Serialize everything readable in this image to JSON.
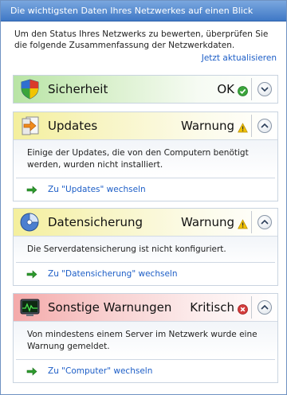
{
  "window": {
    "title": "Die wichtigsten Daten Ihres Netzwerkes auf einen Blick"
  },
  "intro": {
    "text": "Um den Status Ihres Netzwerks zu bewerten, überprüfen Sie die folgende Zusammenfassung der Netzwerkdaten.",
    "refresh_link": "Jetzt aktualisieren"
  },
  "colors": {
    "link": "#1d5ec7",
    "ok_green": "#3aa53a",
    "warning_yellow": "#f2c200",
    "critical_red": "#d43b3b"
  },
  "sections": {
    "security": {
      "title": "Sicherheit",
      "status": "OK",
      "status_icon": "ok-check-icon",
      "icon": "shield-icon",
      "expanded": false
    },
    "updates": {
      "title": "Updates",
      "status": "Warnung",
      "status_icon": "warning-icon",
      "icon": "updates-icon",
      "expanded": true,
      "description": "Einige der Updates, die von den Computern benötigt werden, wurden nicht installiert.",
      "link": "Zu \"Updates\" wechseln"
    },
    "backup": {
      "title": "Datensicherung",
      "status": "Warnung",
      "status_icon": "warning-icon",
      "icon": "backup-icon",
      "expanded": true,
      "description": "Die Serverdatensicherung ist nicht konfiguriert.",
      "link": "Zu \"Datensicherung\" wechseln"
    },
    "other": {
      "title": "Sonstige Warnungen",
      "status": "Kritisch",
      "status_icon": "critical-icon",
      "icon": "monitor-icon",
      "expanded": true,
      "description": "Von mindestens einem Server im Netzwerk wurde eine Warnung gemeldet.",
      "link": "Zu \"Computer\" wechseln"
    }
  }
}
